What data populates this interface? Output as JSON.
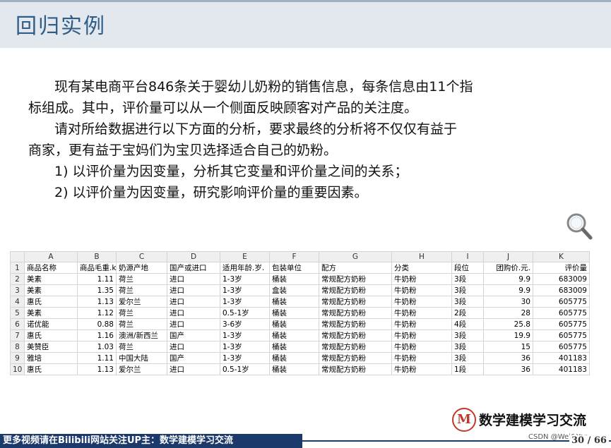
{
  "slide": {
    "title": "回归实例",
    "paragraphs": [
      "现有某电商平台846条关于婴幼儿奶粉的销售信息，每条信息由11个指",
      "标组成。其中，评价量可以从一个侧面反映顾客对产品的关注度。",
      "请对所给数据进行以下方面的分析，要求最终的分析将不仅仅有益于",
      "商家，更有益于宝妈们为宝贝选择适合自己的奶粉。",
      "1) 以评价量为因变量，分析其它变量和评价量之间的关系；",
      "2) 以评价量为因变量，研究影响评价量的重要因素。"
    ],
    "magnifier_icon": "magnifier-icon"
  },
  "sheet": {
    "col_letters": [
      "",
      "A",
      "B",
      "C",
      "D",
      "E",
      "F",
      "G",
      "H",
      "I",
      "J",
      "K"
    ],
    "header_row": [
      "1",
      "商品名称",
      "商品毛重.k",
      "奶源产地",
      "国产或进口",
      "适用年龄.岁.",
      "包装单位",
      "配方",
      "分类",
      "段位",
      "团购价.元.",
      "评价量"
    ],
    "rows": [
      [
        "2",
        "美素",
        "1.11",
        "荷兰",
        "进口",
        "1-3岁",
        "桶装",
        "常规配方奶粉",
        "牛奶粉",
        "3段",
        "9.9",
        "683009"
      ],
      [
        "3",
        "美素",
        "1.35",
        "荷兰",
        "进口",
        "1-3岁",
        "盒装",
        "常规配方奶粉",
        "牛奶粉",
        "3段",
        "9.9",
        "683009"
      ],
      [
        "4",
        "惠氏",
        "1.13",
        "爱尔兰",
        "进口",
        "1-3岁",
        "桶装",
        "常规配方奶粉",
        "牛奶粉",
        "3段",
        "30",
        "605775"
      ],
      [
        "5",
        "美素",
        "1.12",
        "荷兰",
        "进口",
        "0.5-1岁",
        "桶装",
        "常规配方奶粉",
        "牛奶粉",
        "2段",
        "28",
        "605775"
      ],
      [
        "6",
        "诺优能",
        "0.88",
        "荷兰",
        "进口",
        "3-6岁",
        "桶装",
        "常规配方奶粉",
        "牛奶粉",
        "4段",
        "25.8",
        "605775"
      ],
      [
        "7",
        "惠氏",
        "1.16",
        "澳洲/新西兰",
        "国产",
        "1-3岁",
        "桶装",
        "常规配方奶粉",
        "牛奶粉",
        "3段",
        "19.9",
        "605775"
      ],
      [
        "8",
        "美赞臣",
        "1.03",
        "荷兰",
        "进口",
        "1-3岁",
        "桶装",
        "常规配方奶粉",
        "牛奶粉",
        "3段",
        "15",
        "605775"
      ],
      [
        "9",
        "雅培",
        "1.11",
        "中国大陆",
        "国产",
        "1-3岁",
        "桶装",
        "常规配方奶粉",
        "牛奶粉",
        "3段",
        "36",
        "401183"
      ],
      [
        "10",
        "惠氏",
        "1.13",
        "爱尔兰",
        "进口",
        "0.5-1岁",
        "桶装",
        "常规配方奶粉",
        "牛奶粉",
        "1段",
        "36",
        "401183"
      ]
    ]
  },
  "logo": {
    "mark": "M",
    "text": "数学建模学习交流"
  },
  "footer": {
    "text": "更多视频请在Bilibili网站关注UP主：数学建模学习交流",
    "watermark": "CSDN @Wei&Yan",
    "page": "30 / 66"
  },
  "colors": {
    "title": "#2f5d8a",
    "footer_bar": "#1b3a6b",
    "topbar": "#e3e8ee",
    "logo_accent": "#c0392b"
  }
}
